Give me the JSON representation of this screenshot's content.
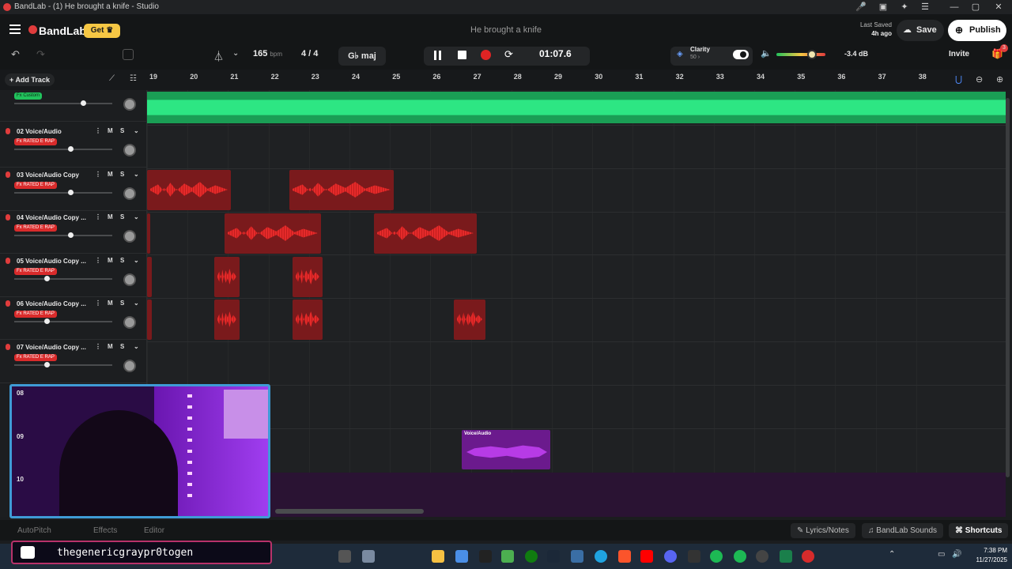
{
  "window": {
    "title": "BandLab - (1) He brought a knife - Studio"
  },
  "header": {
    "logo": "BandLab",
    "get_label": "Get",
    "project_name": "He brought a knife",
    "last_saved_label": "Last Saved",
    "last_saved_time": "4h ago",
    "save_label": "Save",
    "publish_label": "Publish"
  },
  "toolbar": {
    "tempo_value": "165",
    "tempo_unit": "bpm",
    "time_sig": "4 / 4",
    "key": "G♭ maj",
    "time_display": "01:07.6",
    "clarity_label": "Clarity",
    "clarity_value": "50",
    "volume_db": "-3.4 dB",
    "volume_level": 0.72,
    "invite_label": "Invite",
    "gift_count": "3"
  },
  "timeline": {
    "add_track_label": "Add Track",
    "bars": [
      "19",
      "20",
      "21",
      "22",
      "23",
      "24",
      "25",
      "26",
      "27",
      "28",
      "29",
      "30",
      "31",
      "32",
      "33",
      "34",
      "35",
      "36",
      "37",
      "38"
    ]
  },
  "tracks": [
    {
      "name": "",
      "fx": "Fx Custom",
      "fx_color": "green",
      "volume": 0.7
    },
    {
      "name": "02 Voice/Audio",
      "fx": "Fx RATED E RAP",
      "fx_color": "red",
      "volume": 0.57
    },
    {
      "name": "03 Voice/Audio Copy",
      "fx": "Fx RATED E RAP",
      "fx_color": "red",
      "volume": 0.57
    },
    {
      "name": "04 Voice/Audio Copy ...",
      "fx": "Fx RATED E RAP",
      "fx_color": "red",
      "volume": 0.57
    },
    {
      "name": "05 Voice/Audio Copy ...",
      "fx": "Fx RATED E RAP",
      "fx_color": "red",
      "volume": 0.33
    },
    {
      "name": "06 Voice/Audio Copy ...",
      "fx": "Fx RATED E RAP",
      "fx_color": "red",
      "volume": 0.33
    },
    {
      "name": "07 Voice/Audio Copy ...",
      "fx": "Fx RATED E RAP",
      "fx_color": "red",
      "volume": 0.33
    }
  ],
  "hidden_track_numbers": [
    "08",
    "09",
    "10"
  ],
  "purple_clip_label": "Voice/Audio",
  "bottom": {
    "tab_autopitch": "AutoPitch",
    "tab_effects": "Effects",
    "tab_editor": "Editor",
    "lyrics_label": "Lyrics/Notes",
    "sounds_label": "BandLab Sounds",
    "shortcuts_label": "Shortcuts"
  },
  "overlay": {
    "streamer_name": "thegenericgraypr0togen"
  },
  "taskbar": {
    "time": "7:38 PM",
    "date": "11/27/2025"
  },
  "colors": {
    "accent_red": "#e03c3c",
    "clip_green": "#2de683",
    "clip_purple": "#b73be6",
    "get_yellow": "#f6c744"
  }
}
